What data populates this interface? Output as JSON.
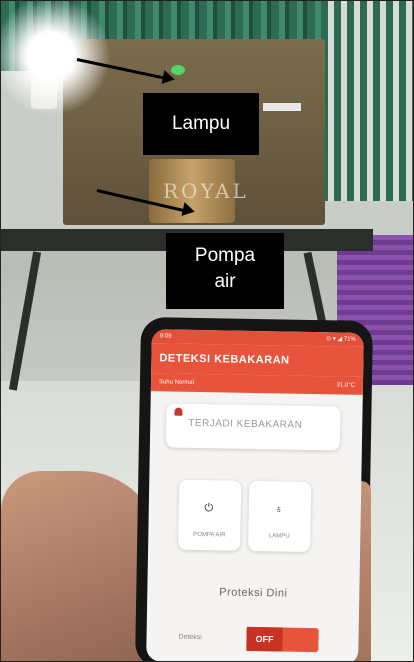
{
  "annotations": {
    "lampu_label": "Lampu",
    "pompa_label_line1": "Pompa",
    "pompa_label_line2": "air"
  },
  "scene": {
    "can_brand": "ROYAL"
  },
  "phone_app": {
    "app_title": "DETEKSI KEBAKARAN",
    "status_left": "9:09",
    "status_right": "⊙ ▾ ◢ 71%",
    "temperature_label": "Suhu Normal",
    "temperature_value": "31,0°C",
    "alert_text": "TERJADI KEBAKARAN",
    "button_pump_label": "POMPA AIR",
    "button_lamp_label": "LAMPU",
    "section_title": "Proteksi Dini",
    "toggle_label": "Deteksi",
    "toggle_state": "OFF"
  },
  "icons": {
    "pump_button_icon": "power-icon",
    "lamp_button_icon": "lightbulb-icon",
    "alert_icon": "bell-icon"
  }
}
